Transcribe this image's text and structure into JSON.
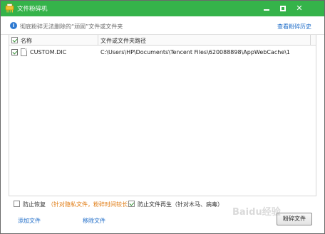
{
  "window": {
    "title": "文件粉碎机",
    "icon": "shredder-app-icon",
    "controls": {
      "minimize": "minimize-icon",
      "maximize": "maximize-icon",
      "close": "close-icon"
    }
  },
  "infobar": {
    "icon": "info-icon",
    "text": "彻底粉碎无法删除的“顽固”文件或文件夹",
    "history_link": "查看粉碎历史"
  },
  "table": {
    "columns": [
      "名称",
      "文件或文件夹路径"
    ],
    "rows": [
      {
        "checked": true,
        "name": "CUSTOM.DIC",
        "path": "C:\\Users\\HP\\Documents\\Tencent Files\\620088898\\AppWebCache\\1"
      }
    ]
  },
  "options": {
    "prevent_recovery": {
      "checked": false,
      "label": "防止恢复",
      "note": "（针对隐私文件，粉碎时间较长）"
    },
    "prevent_regeneration": {
      "checked": true,
      "label": "防止文件再生（针对木马、病毒）"
    }
  },
  "footer": {
    "add_file": "添加文件",
    "remove_file": "移除文件",
    "shred_button": "粉碎文件"
  },
  "watermark": "Baidu经验",
  "colors": {
    "titlebar": "#35b34a",
    "link": "#1e6cc8",
    "note": "#e07a10"
  }
}
